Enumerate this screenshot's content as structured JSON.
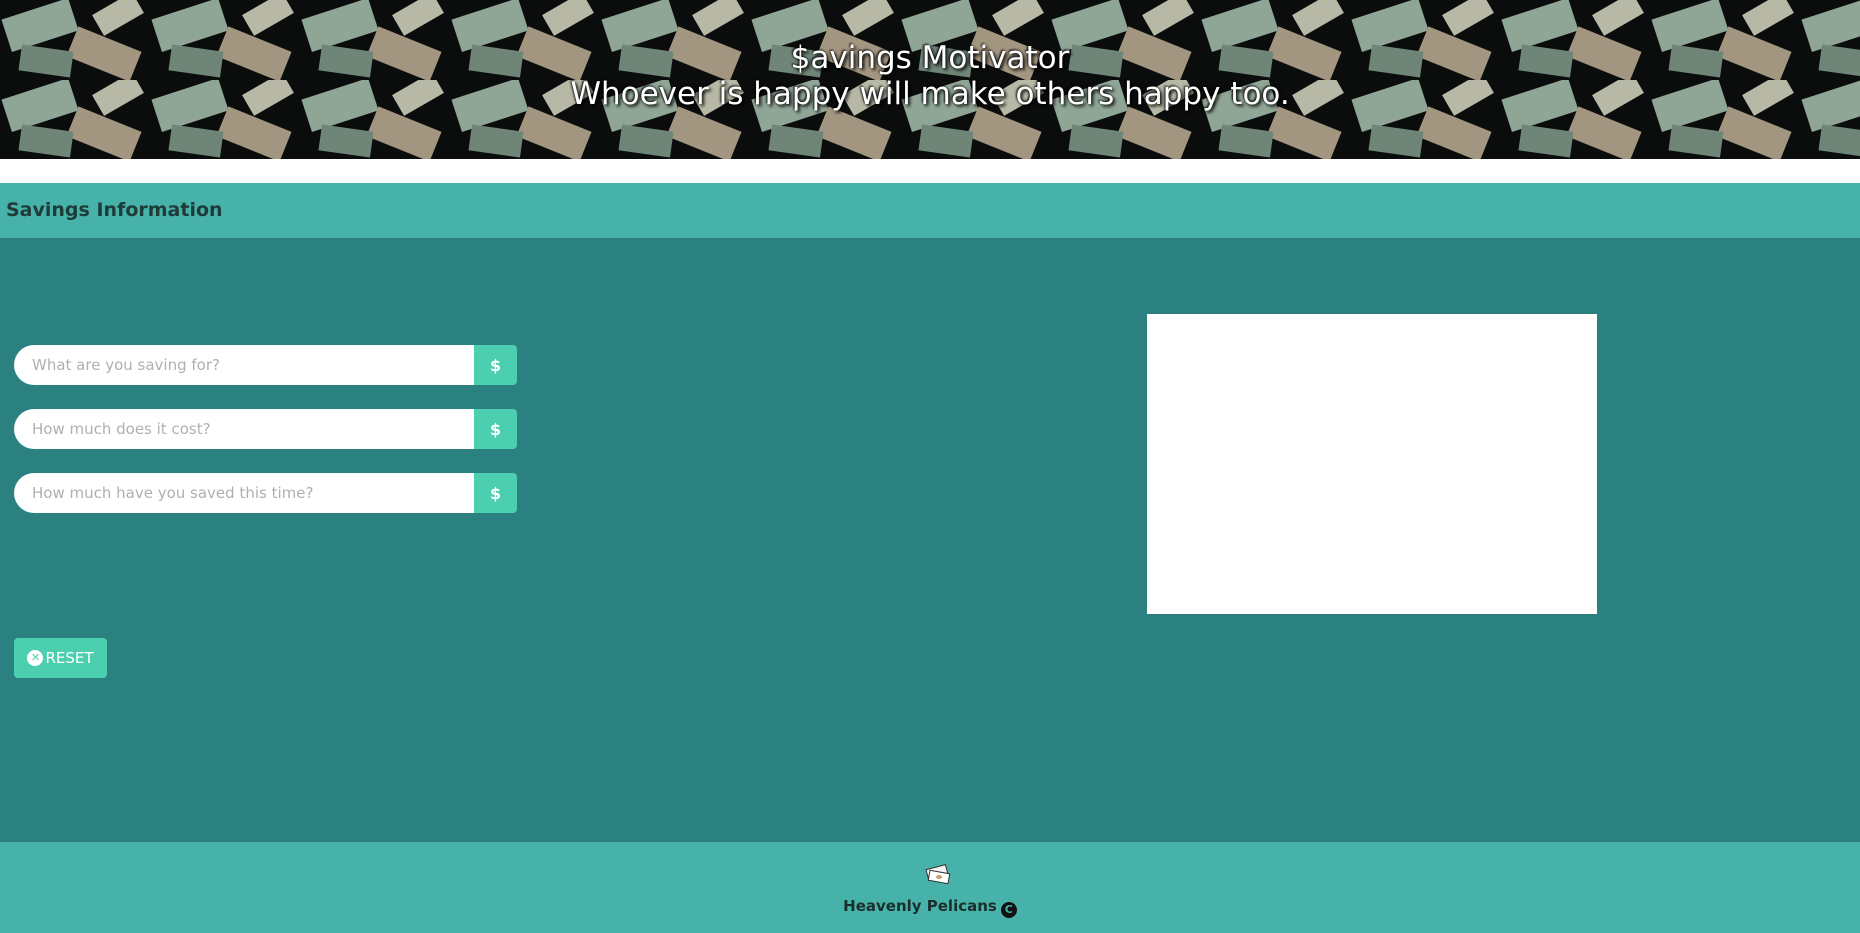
{
  "header": {
    "title": "$avings Motivator",
    "subtitle": "Whoever is happy will make others happy too."
  },
  "section": {
    "title": "Savings Information"
  },
  "form": {
    "fields": [
      {
        "placeholder": "What are you saving for?",
        "value": "",
        "addon_icon": "dollar-icon",
        "addon_symbol": "$"
      },
      {
        "placeholder": "How much does it cost?",
        "value": "",
        "addon_icon": "dollar-icon",
        "addon_symbol": "$"
      },
      {
        "placeholder": "How much have you saved this time?",
        "value": "",
        "addon_icon": "dollar-icon",
        "addon_symbol": "$"
      }
    ],
    "reset_label": "RESET",
    "reset_icon": "close-circle-icon",
    "reset_symbol": "✕"
  },
  "footer": {
    "brand": "Heavenly Pelicans",
    "logo_icon": "money-stack-icon",
    "copyright_icon": "copyright-icon",
    "copyright_symbol": "C"
  },
  "colors": {
    "banner_bg": "#0b0d0c",
    "section_header": "#47b2aa",
    "main_panel": "#2b8180",
    "accent_button": "#4ccfae",
    "footer": "#47b2aa"
  }
}
